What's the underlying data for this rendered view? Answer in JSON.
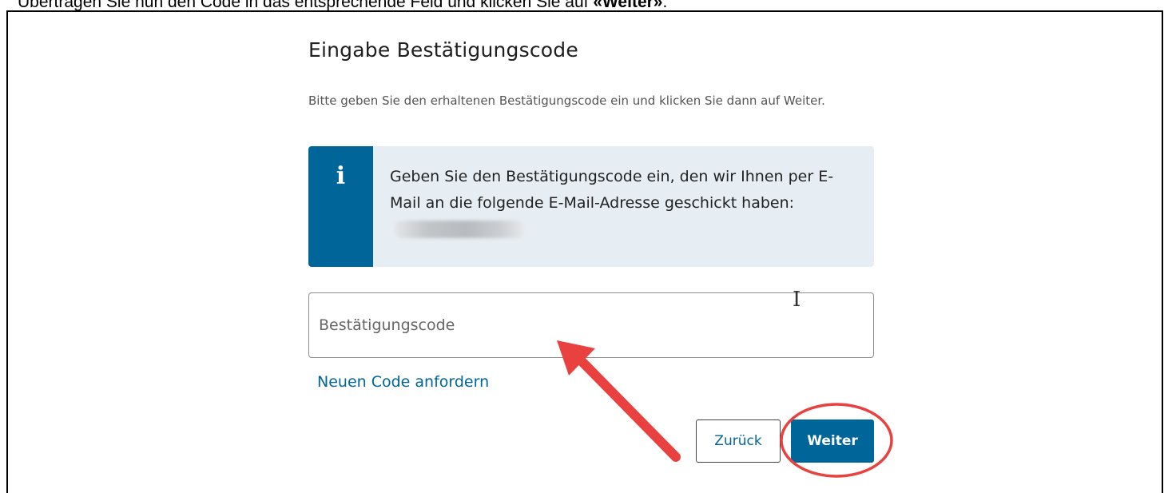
{
  "caption": {
    "prefix": "Übertragen Sie nun den Code in das entsprechende Feld und klicken Sie auf ",
    "bold": "«Weiter»",
    "suffix": "."
  },
  "form": {
    "title": "Eingabe Bestätigungscode",
    "intro": "Bitte geben Sie den erhaltenen Bestätigungscode ein und klicken Sie dann auf Weiter.",
    "info": {
      "icon": "info-icon",
      "text": "Geben Sie den Bestätigungscode ein, den wir Ihnen per E-Mail an die folgende E-Mail-Adresse geschickt haben:"
    },
    "code_placeholder": "Bestätigungscode",
    "code_value": "",
    "new_code_link": "Neuen Code anfordern",
    "back_button": "Zurück",
    "next_button": "Weiter"
  },
  "colors": {
    "primary": "#006699",
    "info_background": "#e7eef3",
    "annotation_red": "#e8413f"
  }
}
